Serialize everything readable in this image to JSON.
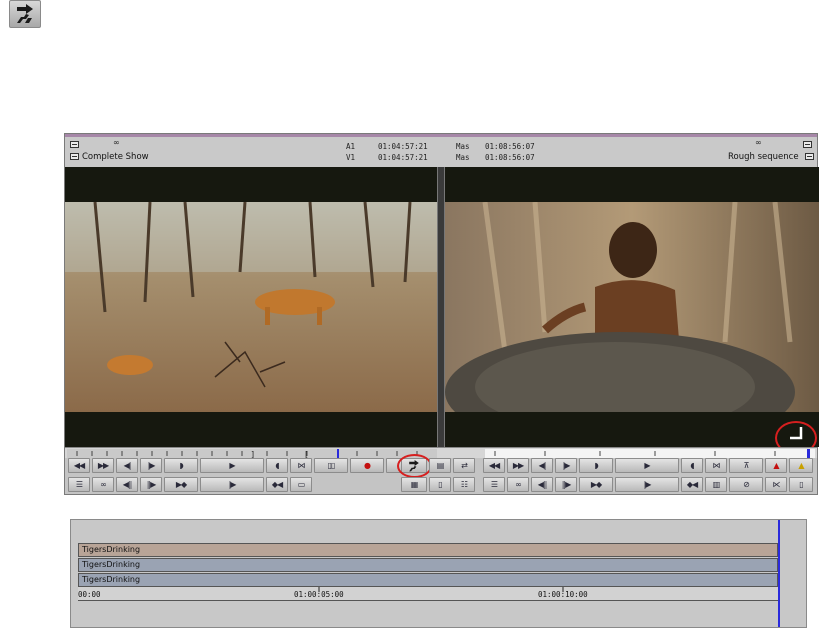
{
  "top_icon": {
    "name": "segment-mode-icon"
  },
  "composer": {
    "source": {
      "name": "Complete Show",
      "track_a_label": "A1",
      "track_a_tc": "01:04:57:21",
      "track_v_label": "V1",
      "track_v_tc": "01:04:57:21"
    },
    "record": {
      "name": "Rough sequence",
      "mas_label_1": "Mas",
      "mas_tc_1": "01:08:56:07",
      "mas_label_2": "Mas",
      "mas_tc_2": "01:08:56:07"
    },
    "colors": {
      "title_bar": "#a687a8",
      "highlight": "#d61f1f"
    }
  },
  "timeline": {
    "tracks": [
      {
        "label": "TigersDrinking",
        "color": "#b8a497"
      },
      {
        "label": "TigersDrinking",
        "color": "#9aa3b3"
      },
      {
        "label": "TigersDrinking",
        "color": "#9aa3b3"
      }
    ],
    "ruler": {
      "tc_start": "00:00",
      "tc_mid": "01:00:05:00",
      "tc_end": "01:00:10:00"
    },
    "position_color": "#2a2adc"
  }
}
